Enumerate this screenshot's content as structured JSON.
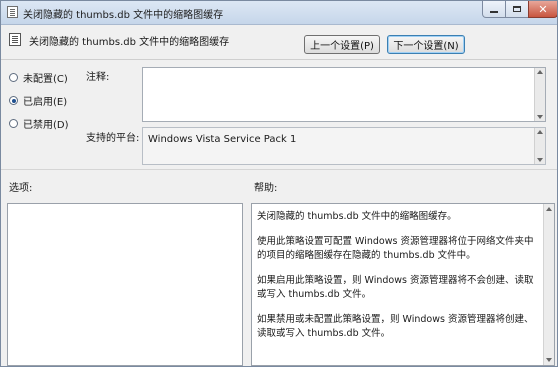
{
  "window": {
    "title": "关闭隐藏的 thumbs.db 文件中的缩略图缓存"
  },
  "header": {
    "policy_title": "关闭隐藏的 thumbs.db 文件中的缩略图缓存",
    "prev_button": "上一个设置(P)",
    "next_button": "下一个设置(N)"
  },
  "state": {
    "options": [
      {
        "label": "未配置(C)",
        "checked": false
      },
      {
        "label": "已启用(E)",
        "checked": true
      },
      {
        "label": "已禁用(D)",
        "checked": false
      }
    ]
  },
  "comment": {
    "label": "注释:",
    "value": ""
  },
  "platform": {
    "label": "支持的平台:",
    "value": "Windows Vista Service Pack 1"
  },
  "options_section": {
    "label": "选项:"
  },
  "help_section": {
    "label": "帮助:",
    "paragraphs": [
      "关闭隐藏的 thumbs.db 文件中的缩略图缓存。",
      "使用此策略设置可配置 Windows 资源管理器将位于网络文件夹中的项目的缩略图缓存在隐藏的 thumbs.db 文件中。",
      "如果启用此策略设置，则 Windows 资源管理器将不会创建、读取或写入 thumbs.db 文件。",
      "如果禁用或未配置此策略设置，则 Windows 资源管理器将创建、读取或写入 thumbs.db 文件。"
    ]
  }
}
